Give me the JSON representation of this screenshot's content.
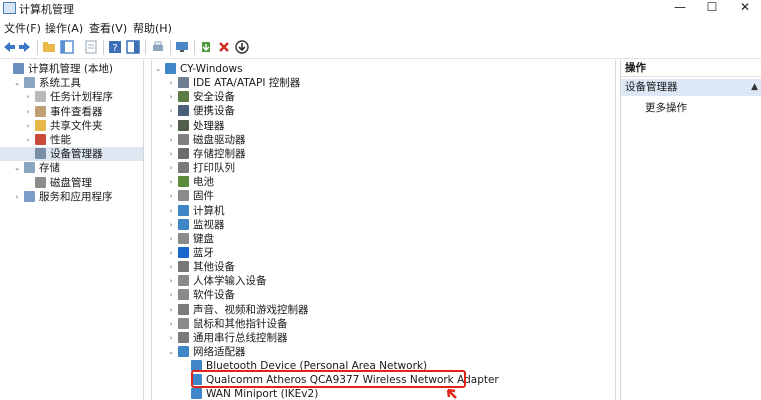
{
  "window": {
    "title": "计算机管理",
    "buttons": [
      "—",
      "☐",
      "✕"
    ]
  },
  "menu": [
    "文件(F)",
    "操作(A)",
    "查看(V)",
    "帮助(H)"
  ],
  "toolbar": {
    "colors": [
      "#3a76c4",
      "#3a76c4",
      "#e9b94a",
      "#5b8fd1",
      "#a7b3c1",
      "#3c6fb8",
      "#3c6fb8",
      "#8ea4bf",
      "#4a87c7",
      "#4d9a3b",
      "#d02b20",
      "#333333"
    ]
  },
  "left_tree": [
    {
      "label": "计算机管理 (本地)",
      "tw": "",
      "indent": 0,
      "icon": "computer-management-icon",
      "color": "#6a8fbf"
    },
    {
      "label": "系统工具",
      "tw": "⌄",
      "indent": 1,
      "icon": "tools-icon",
      "color": "#8aa5c0"
    },
    {
      "label": "任务计划程序",
      "tw": "›",
      "indent": 2,
      "icon": "clock-icon",
      "color": "#b9b9b9"
    },
    {
      "label": "事件查看器",
      "tw": "›",
      "indent": 2,
      "icon": "event-viewer-icon",
      "color": "#c0a070"
    },
    {
      "label": "共享文件夹",
      "tw": "›",
      "indent": 2,
      "icon": "shared-folder-icon",
      "color": "#e6b84a"
    },
    {
      "label": "性能",
      "tw": "›",
      "indent": 2,
      "icon": "performance-icon",
      "color": "#c94a3a"
    },
    {
      "label": "设备管理器",
      "tw": "",
      "indent": 2,
      "icon": "device-manager-icon",
      "color": "#7a8fa6",
      "selected": true
    },
    {
      "label": "存储",
      "tw": "⌄",
      "indent": 1,
      "icon": "storage-icon",
      "color": "#8aa5c0"
    },
    {
      "label": "磁盘管理",
      "tw": "",
      "indent": 2,
      "icon": "disk-management-icon",
      "color": "#8c8c8c"
    },
    {
      "label": "服务和应用程序",
      "tw": "›",
      "indent": 1,
      "icon": "services-icon",
      "color": "#7a9cc6"
    }
  ],
  "device_tree": [
    {
      "label": "CY-Windows",
      "tw": "⌄",
      "indent": 0,
      "icon": "computer-icon",
      "color": "#3f86c9"
    },
    {
      "label": "IDE ATA/ATAPI 控制器",
      "tw": "›",
      "indent": 1,
      "icon": "ide-controller-icon",
      "color": "#6e7f91"
    },
    {
      "label": "安全设备",
      "tw": "›",
      "indent": 1,
      "icon": "security-device-icon",
      "color": "#5a7b45"
    },
    {
      "label": "便携设备",
      "tw": "›",
      "indent": 1,
      "icon": "portable-device-icon",
      "color": "#4a5f7a"
    },
    {
      "label": "处理器",
      "tw": "›",
      "indent": 1,
      "icon": "processor-icon",
      "color": "#4f5d4a"
    },
    {
      "label": "磁盘驱动器",
      "tw": "›",
      "indent": 1,
      "icon": "disk-drive-icon",
      "color": "#808080"
    },
    {
      "label": "存储控制器",
      "tw": "›",
      "indent": 1,
      "icon": "storage-controller-icon",
      "color": "#6b6b6b"
    },
    {
      "label": "打印队列",
      "tw": "›",
      "indent": 1,
      "icon": "printer-icon",
      "color": "#7a7a7a"
    },
    {
      "label": "电池",
      "tw": "›",
      "indent": 1,
      "icon": "battery-icon",
      "color": "#5d8b3c"
    },
    {
      "label": "固件",
      "tw": "›",
      "indent": 1,
      "icon": "firmware-icon",
      "color": "#8a8a8a"
    },
    {
      "label": "计算机",
      "tw": "›",
      "indent": 1,
      "icon": "computer-icon",
      "color": "#3f86c9"
    },
    {
      "label": "监视器",
      "tw": "›",
      "indent": 1,
      "icon": "monitor-icon",
      "color": "#3f86c9"
    },
    {
      "label": "键盘",
      "tw": "›",
      "indent": 1,
      "icon": "keyboard-icon",
      "color": "#8a8a8a"
    },
    {
      "label": "蓝牙",
      "tw": "›",
      "indent": 1,
      "icon": "bluetooth-icon",
      "color": "#1a66c9"
    },
    {
      "label": "其他设备",
      "tw": "›",
      "indent": 1,
      "icon": "other-devices-icon",
      "color": "#777777"
    },
    {
      "label": "人体学输入设备",
      "tw": "›",
      "indent": 1,
      "icon": "hid-icon",
      "color": "#8a8a8a"
    },
    {
      "label": "软件设备",
      "tw": "›",
      "indent": 1,
      "icon": "software-device-icon",
      "color": "#8a8a8a"
    },
    {
      "label": "声音、视频和游戏控制器",
      "tw": "›",
      "indent": 1,
      "icon": "sound-icon",
      "color": "#7a7a7a"
    },
    {
      "label": "鼠标和其他指针设备",
      "tw": "›",
      "indent": 1,
      "icon": "mouse-icon",
      "color": "#8a8a8a"
    },
    {
      "label": "通用串行总线控制器",
      "tw": "›",
      "indent": 1,
      "icon": "usb-icon",
      "color": "#7a7a7a"
    },
    {
      "label": "网络适配器",
      "tw": "⌄",
      "indent": 1,
      "icon": "network-adapter-icon",
      "color": "#3f86c9"
    },
    {
      "label": "Bluetooth Device (Personal Area Network)",
      "tw": "",
      "indent": 2,
      "icon": "network-adapter-icon",
      "color": "#3f86c9"
    },
    {
      "label": "Qualcomm Atheros QCA9377 Wireless Network Adapter",
      "tw": "",
      "indent": 2,
      "icon": "network-adapter-icon",
      "color": "#3f86c9"
    },
    {
      "label": "WAN Miniport (IKEv2)",
      "tw": "",
      "indent": 2,
      "icon": "network-adapter-icon",
      "color": "#3f86c9"
    }
  ],
  "actions": {
    "header": "操作",
    "section": "设备管理器",
    "more": "更多操作"
  },
  "highlight": {
    "color": "#e1251b"
  }
}
